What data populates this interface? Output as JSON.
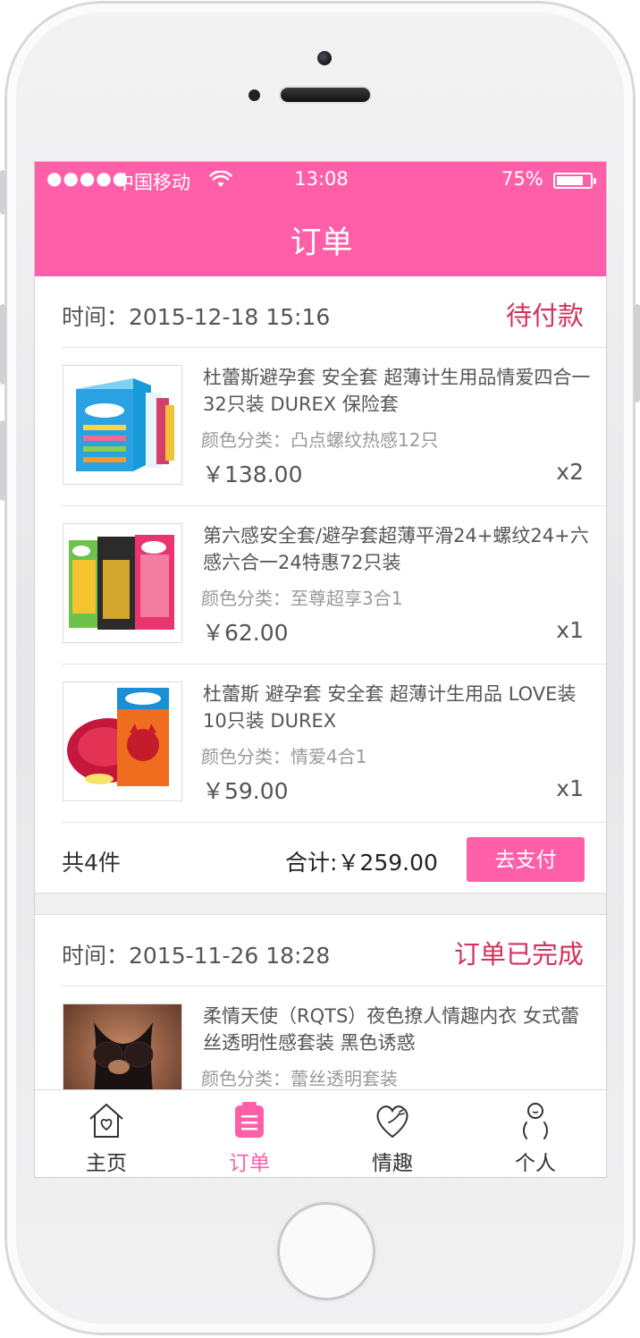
{
  "status_bar": {
    "signal": "●●●●●",
    "carrier": "中国移动",
    "time": "13:08",
    "battery": "75%"
  },
  "nav": {
    "title": "订单"
  },
  "orders": [
    {
      "time": "时间：2015-12-18 15:16",
      "status": "待付款",
      "items": [
        {
          "title": "杜蕾斯避孕套 安全套 超薄计生用品情爱四合一 32只装 DUREX 保险套",
          "spec": "颜色分类：凸点螺纹热感12只",
          "price": "￥138.00",
          "qty": "x2"
        },
        {
          "title": "第六感安全套/避孕套超薄平滑24+螺纹24+六感六合一24特惠72只装",
          "spec": "颜色分类：至尊超享3合1",
          "price": "￥62.00",
          "qty": "x1"
        },
        {
          "title": "杜蕾斯 避孕套 安全套 超薄计生用品 LOVE装10只装 DUREX",
          "spec": "颜色分类：情爱4合1",
          "price": "￥59.00",
          "qty": "x1"
        }
      ],
      "count": "共4件",
      "total": "合计:￥259.00",
      "action": "去支付"
    },
    {
      "time": "时间：2015-11-26 18:28",
      "status": "订单已完成",
      "items": [
        {
          "title": "柔情天使（RQTS）夜色撩人情趣内衣 女式蕾丝透明性感套装 黑色诱惑",
          "spec": "颜色分类：蕾丝透明套装"
        }
      ]
    }
  ],
  "tabs": [
    {
      "label": "主页",
      "icon": "home-icon"
    },
    {
      "label": "订单",
      "icon": "order-icon"
    },
    {
      "label": "情趣",
      "icon": "heart-icon"
    },
    {
      "label": "个人",
      "icon": "person-icon"
    }
  ],
  "colors": {
    "brand_pink": "#ff5fa9",
    "status_red": "#d2325f"
  }
}
